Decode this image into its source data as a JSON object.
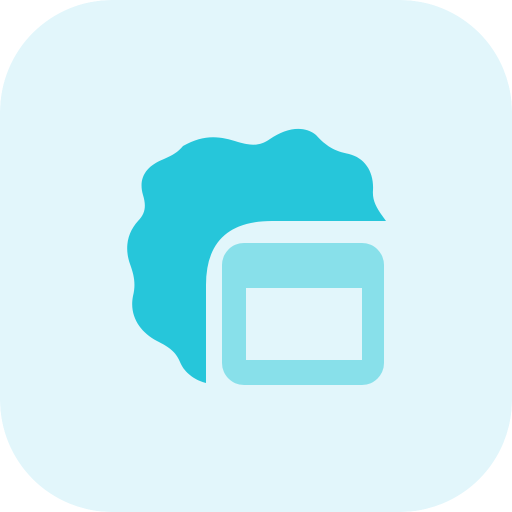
{
  "icon": {
    "name": "app-settings-window-icon",
    "parts": {
      "badge": "gear-badge-icon",
      "window": "browser-window-icon"
    }
  },
  "colors": {
    "tile_background": "#E2F6FB",
    "badge_fill": "#26C6DA",
    "window_frame": "#88E0EA",
    "window_pane": "#E2F6FB"
  }
}
